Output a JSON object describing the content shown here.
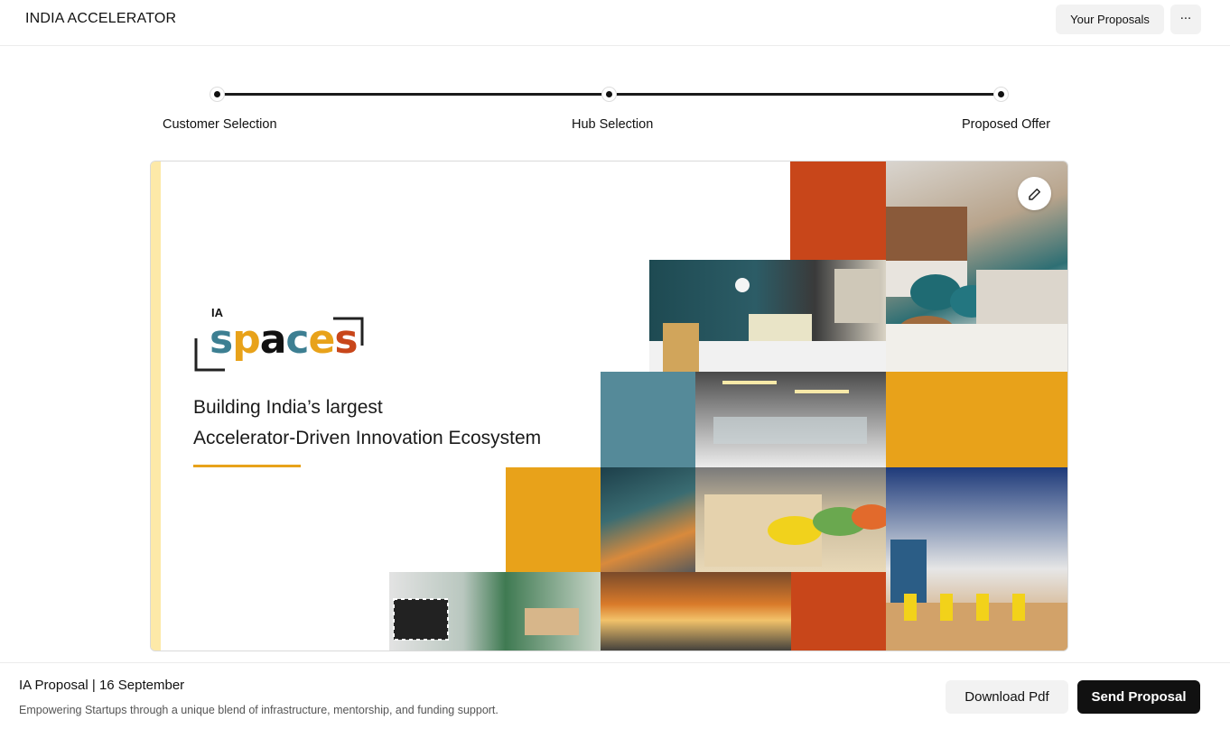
{
  "header": {
    "brand": "INDIA ACCELERATOR",
    "proposals_label": "Your Proposals",
    "more_label": "···"
  },
  "stepper": {
    "steps": [
      {
        "label": "Customer Selection"
      },
      {
        "label": "Hub Selection"
      },
      {
        "label": "Proposed Offer"
      }
    ]
  },
  "slide": {
    "logo_mark": "IA",
    "logo_word": "spaces",
    "headline_line1": "Building India’s largest",
    "headline_line2": "Accelerator-Driven Innovation Ecosystem",
    "colors": {
      "orange": "#c8461a",
      "yellow": "#e8a21a",
      "teal": "#558a99",
      "stripe": "#fde9a8"
    },
    "edit_icon": "edit-icon"
  },
  "footer": {
    "title": "IA Proposal | 16 September",
    "subtitle": "Empowering Startups through a unique blend of infrastructure, mentorship, and funding support.",
    "download_label": "Download Pdf",
    "send_label": "Send Proposal"
  }
}
